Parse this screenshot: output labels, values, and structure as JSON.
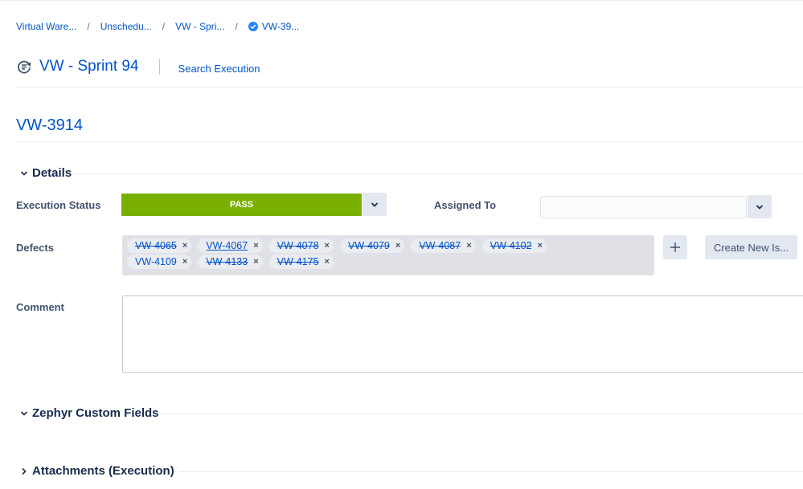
{
  "breadcrumb": {
    "items": [
      "Virtual Ware...",
      "Unschedu...",
      "VW - Spri...",
      "VW-39..."
    ],
    "separator": "/"
  },
  "header": {
    "sprint_title": "VW - Sprint 94",
    "search_link": "Search Execution"
  },
  "issue": {
    "key": "VW-3914"
  },
  "details": {
    "section_title": "Details",
    "execution_status_label": "Execution Status",
    "execution_status_value": "PASS",
    "execution_status_color": "#79b000",
    "assigned_to_label": "Assigned To",
    "assigned_to_value": "",
    "defects_label": "Defects",
    "defects": [
      {
        "key": "VW-4065",
        "state": "resolved"
      },
      {
        "key": "VW-4067",
        "state": "open"
      },
      {
        "key": "VW-4078",
        "state": "resolved"
      },
      {
        "key": "VW-4079",
        "state": "resolved"
      },
      {
        "key": "VW-4087",
        "state": "resolved"
      },
      {
        "key": "VW-4102",
        "state": "resolved"
      },
      {
        "key": "VW-4109",
        "state": "plain"
      },
      {
        "key": "VW-4133",
        "state": "resolved"
      },
      {
        "key": "VW-4175",
        "state": "resolved"
      }
    ],
    "remove_glyph": "×",
    "create_new_label": "Create New Is...",
    "comment_label": "Comment",
    "comment_value": ""
  },
  "sections": {
    "custom_fields": "Zephyr Custom Fields",
    "attachments": "Attachments (Execution)"
  },
  "colors": {
    "link": "#0052cc",
    "pass": "#79b000"
  }
}
